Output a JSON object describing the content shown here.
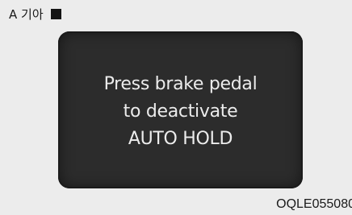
{
  "type_label": "A 기아",
  "type_label_icon": "square-icon",
  "display": {
    "lines": [
      "Press brake pedal",
      "to deactivate",
      "AUTO HOLD"
    ]
  },
  "image_code": "OQLE055080",
  "colors": {
    "background": "#ececec",
    "display_bg": "#2c2c2c",
    "display_text": "#ececec"
  }
}
